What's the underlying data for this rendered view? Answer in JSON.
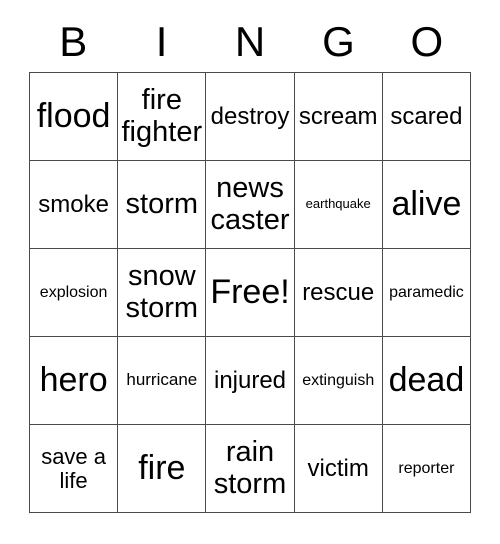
{
  "card": {
    "title": "BINGO",
    "header_letters": [
      "B",
      "I",
      "N",
      "G",
      "O"
    ],
    "free_space": "Free!",
    "colors": {
      "background": "#ffffff",
      "text": "#000000",
      "grid_line": "#4a4a4a"
    },
    "rows": [
      [
        {
          "text": "flood",
          "size": "fs-xl"
        },
        {
          "text": "fire\nfighter",
          "size": "fs-lg"
        },
        {
          "text": "destroy",
          "size": "fs-md"
        },
        {
          "text": "scream",
          "size": "fs-md"
        },
        {
          "text": "scared",
          "size": "fs-md"
        }
      ],
      [
        {
          "text": "smoke",
          "size": "fs-md"
        },
        {
          "text": "storm",
          "size": "fs-lg"
        },
        {
          "text": "news\ncaster",
          "size": "fs-lg"
        },
        {
          "text": "earthquake",
          "size": "fs-tiny"
        },
        {
          "text": "alive",
          "size": "fs-xl"
        }
      ],
      [
        {
          "text": "explosion",
          "size": "fs-xxs"
        },
        {
          "text": "snow\nstorm",
          "size": "fs-lg"
        },
        {
          "text": "Free!",
          "size": "fs-xl"
        },
        {
          "text": "rescue",
          "size": "fs-md"
        },
        {
          "text": "paramedic",
          "size": "fs-xxs"
        }
      ],
      [
        {
          "text": "hero",
          "size": "fs-xl"
        },
        {
          "text": "hurricane",
          "size": "fs-xs"
        },
        {
          "text": "injured",
          "size": "fs-md"
        },
        {
          "text": "extinguish",
          "size": "fs-xxs"
        },
        {
          "text": "dead",
          "size": "fs-xl"
        }
      ],
      [
        {
          "text": "save a\nlife",
          "size": "fs-sm"
        },
        {
          "text": "fire",
          "size": "fs-xl"
        },
        {
          "text": "rain\nstorm",
          "size": "fs-lg"
        },
        {
          "text": "victim",
          "size": "fs-md"
        },
        {
          "text": "reporter",
          "size": "fs-xxs"
        }
      ]
    ]
  }
}
